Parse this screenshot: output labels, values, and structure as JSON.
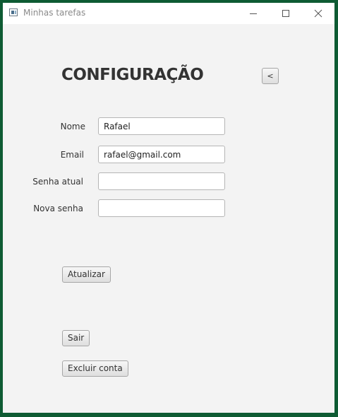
{
  "window": {
    "title": "Minhas tarefas"
  },
  "page": {
    "heading": "CONFIGURAÇÃO",
    "back_label": "<"
  },
  "form": {
    "name_label": "Nome",
    "name_value": "Rafael",
    "email_label": "Email",
    "email_value": "rafael@gmail.com",
    "current_password_label": "Senha atual",
    "current_password_value": "",
    "new_password_label": "Nova senha",
    "new_password_value": ""
  },
  "actions": {
    "update_label": "Atualizar",
    "logout_label": "Sair",
    "delete_account_label": "Excluir conta"
  }
}
